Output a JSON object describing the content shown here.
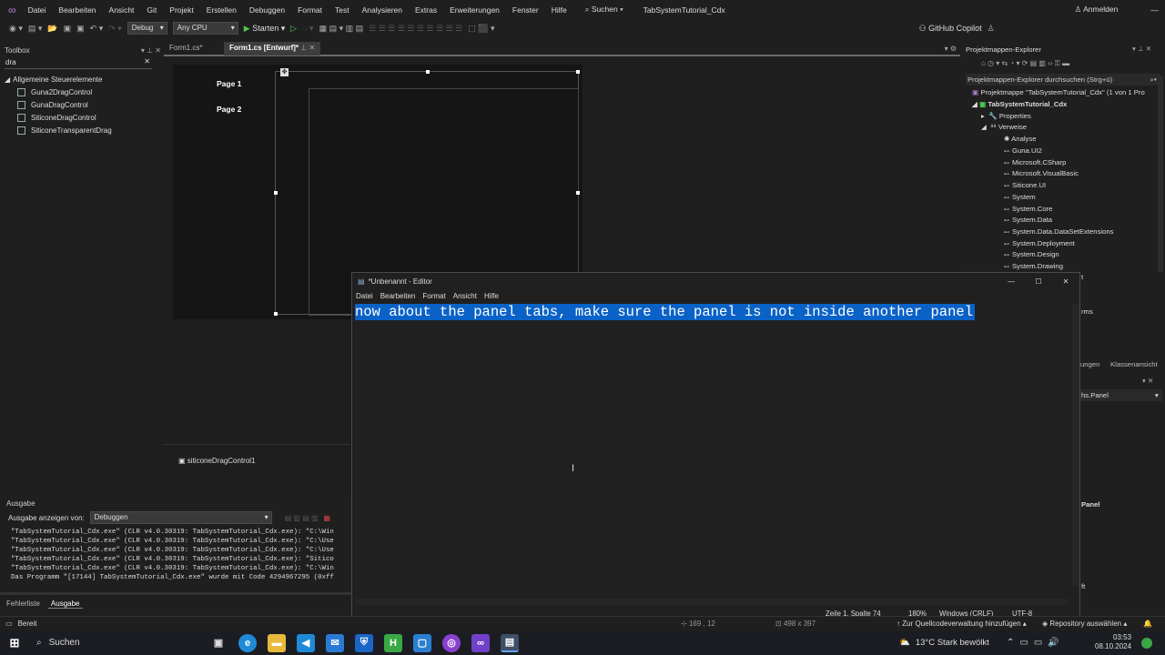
{
  "menubar": {
    "items": [
      "Datei",
      "Bearbeiten",
      "Ansicht",
      "Git",
      "Projekt",
      "Erstellen",
      "Debuggen",
      "Format",
      "Test",
      "Analysieren",
      "Extras",
      "Erweiterungen",
      "Fenster",
      "Hilfe"
    ],
    "search": "Suchen",
    "project_title": "TabSystemTutorial_Cdx",
    "signin": "Anmelden"
  },
  "toolbar": {
    "config": "Debug",
    "platform": "Any CPU",
    "start": "Starten",
    "copilot": "GitHub Copilot"
  },
  "toolbox": {
    "title": "Toolbox",
    "search_value": "dra",
    "group": "Allgemeine Steuerelemente",
    "items": [
      "Guna2DragControl",
      "GunaDragControl",
      "SiticoneDragControl",
      "SiticoneTransparentDrag"
    ]
  },
  "doc_tabs": {
    "tab1": "Form1.cs*",
    "tab2": "Form1.cs [Entwurf]*"
  },
  "designer": {
    "page1": "Page 1",
    "page2": "Page 2",
    "tray_item": "siticoneDragControl1"
  },
  "output": {
    "title": "Ausgabe",
    "show_label": "Ausgabe anzeigen von:",
    "source": "Debuggen",
    "lines": [
      "\"TabSystemTutorial_Cdx.exe\" (CLR v4.0.30319: TabSystemTutorial_Cdx.exe): \"C:\\Win",
      "\"TabSystemTutorial_Cdx.exe\" (CLR v4.0.30319: TabSystemTutorial_Cdx.exe): \"C:\\Use",
      "\"TabSystemTutorial_Cdx.exe\" (CLR v4.0.30319: TabSystemTutorial_Cdx.exe): \"C:\\Use",
      "\"TabSystemTutorial_Cdx.exe\" (CLR v4.0.30319: TabSystemTutorial_Cdx.exe): \"Sitico",
      "\"TabSystemTutorial_Cdx.exe\" (CLR v4.0.30319: TabSystemTutorial_Cdx.exe): \"C:\\Win",
      "Das Programm \"[17144] TabSystemTutorial_Cdx.exe\" wurde mit Code 4294967295 (0xff"
    ],
    "tab_errors": "Fehlerliste",
    "tab_output": "Ausgabe"
  },
  "solution": {
    "title": "Projektmappen-Explorer",
    "search": "Projektmappen-Explorer durchsuchen (Strg+ü)",
    "root": "Projektmappe \"TabSystemTutorial_Cdx\" (1 von 1 Pro",
    "project": "TabSystemTutorial_Cdx",
    "properties": "Properties",
    "references": "Verweise",
    "analyzers": "Analyse",
    "refs": [
      "Guna.UI2",
      "Microsoft.CSharp",
      "Microsoft.VisualBasic",
      "Siticone.UI",
      "System",
      "System.Core",
      "System.Data",
      "System.Data.DataSetExtensions",
      "System.Deployment",
      "System.Design",
      "System.Drawing"
    ],
    "partial_t": "t",
    "partial_rms": "rms",
    "tab_partial": "ungen",
    "tab_classes": "Klassenansicht",
    "prop_partial": "hs.Panel",
    "prop_panel": "Panel",
    "prop_ft": "ft"
  },
  "notepad": {
    "title": "*Unbenannt - Editor",
    "menu": [
      "Datei",
      "Bearbeiten",
      "Format",
      "Ansicht",
      "Hilfe"
    ],
    "text": "now about the panel tabs, make sure the panel is not inside another panel",
    "position": "Zeile 1, Spalte 74",
    "zoom": "180%",
    "eol": "Windows (CRLF)",
    "encoding": "UTF-8"
  },
  "statusbar": {
    "ready": "Bereit",
    "coords": "169 , 12",
    "size": "498 x 397",
    "source_control": "Zur Quellcodeverwaltung hinzufügen",
    "repo": "Repository auswählen"
  },
  "taskbar": {
    "search": "Suchen",
    "weather": "13°C  Stark bewölkt",
    "time": "03:53",
    "date": "08.10.2024"
  },
  "colors": {
    "selection": "#0a62c7",
    "vs_purple": "#b180d7"
  }
}
